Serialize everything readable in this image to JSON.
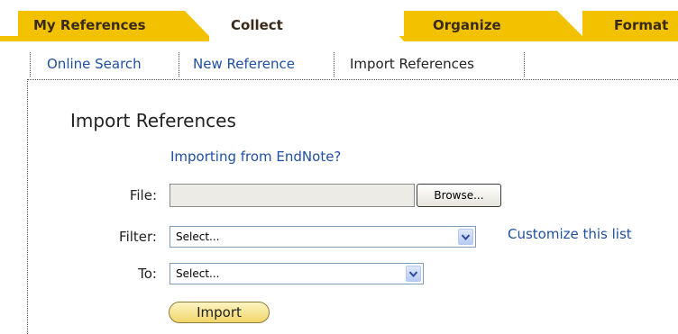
{
  "colors": {
    "tab_inactive": "#f2c200",
    "tab_active": "#ffffff",
    "tab_bar_line": "#f2c200",
    "link": "#1f4f9f",
    "import_button": "#f0d66a"
  },
  "tabs": [
    {
      "label": "My References",
      "active": false
    },
    {
      "label": "Collect",
      "active": true
    },
    {
      "label": "Organize",
      "active": false
    },
    {
      "label": "Format",
      "active": false
    }
  ],
  "subnav": {
    "online_search": "Online Search",
    "new_reference": "New Reference",
    "import_references": "Import References"
  },
  "main": {
    "heading": "Import References",
    "endnote_link": "Importing from EndNote?",
    "file_label": "File:",
    "browse_label": "Browse...",
    "filter_label": "Filter:",
    "filter_value": "Select...",
    "customize_link": "Customize this list",
    "to_label": "To:",
    "to_value": "Select...",
    "import_button": "Import"
  },
  "icons": {
    "dropdown_arrow": "chevron-down-icon"
  }
}
